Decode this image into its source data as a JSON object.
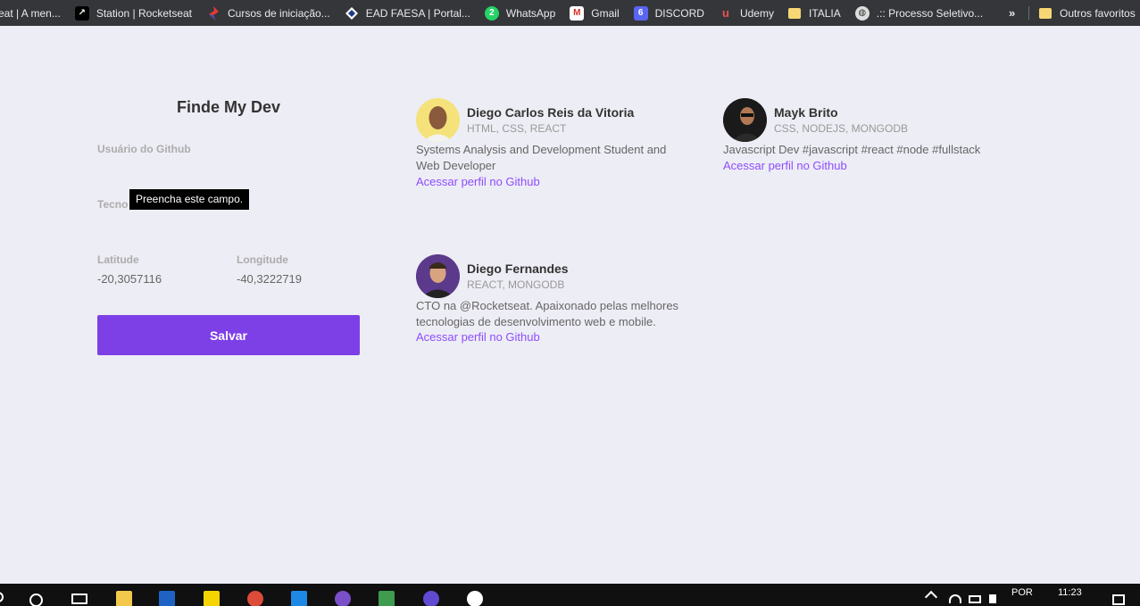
{
  "bookmarks_bar": {
    "items": [
      {
        "label": "eat | A men...",
        "icon": "page-icon",
        "color": "#35363a"
      },
      {
        "label": "Station | Rocketseat",
        "icon": "rocketseat-icon",
        "color": "#000000"
      },
      {
        "label": "Cursos de iniciação...",
        "icon": "bookmark-logo-icon",
        "color": "#e53935"
      },
      {
        "label": "EAD FAESA | Portal...",
        "icon": "faesa-icon",
        "color": "#1e3a8a"
      },
      {
        "label": "WhatsApp",
        "icon": "whatsapp-icon",
        "color": "#25d366"
      },
      {
        "label": "Gmail",
        "icon": "gmail-icon",
        "color": "#ffffff"
      },
      {
        "label": "DISCORD",
        "icon": "discord-icon",
        "color": "#5865f2"
      },
      {
        "label": "Udemy",
        "icon": "udemy-icon",
        "color": "#ec5252"
      },
      {
        "label": "ITALIA",
        "icon": "folder-icon",
        "color": "#f7d774"
      },
      {
        "label": ".:: Processo Seletivo...",
        "icon": "globe-icon",
        "color": "#dddddd"
      }
    ],
    "overflow_label": "»",
    "other_favorites": "Outros favoritos"
  },
  "form": {
    "title": "Finde My Dev",
    "github_label": "Usuário do Github",
    "techs_label": "Tecno",
    "tooltip": "Preencha este campo.",
    "latitude_label": "Latitude",
    "latitude_value": "-20,3057116",
    "longitude_label": "Longitude",
    "longitude_value": "-40,3222719",
    "save_label": "Salvar"
  },
  "devs": [
    {
      "name": "Diego Carlos Reis da Vitoria",
      "techs": "HTML, CSS, REACT",
      "bio": "Systems Analysis and Development Student and Web Developer",
      "link": "Acessar perfil no Github",
      "avatar_color": "#f5e27a"
    },
    {
      "name": "Mayk Brito",
      "techs": "CSS, NODEJS, MONGODB",
      "bio": "Javascript Dev #javascript #react #node #fullstack",
      "link": "Acessar perfil no Github",
      "avatar_color": "#1a1a1a"
    },
    {
      "name": "Diego Fernandes",
      "techs": "REACT, MONGODB",
      "bio": "CTO na @Rocketseat. Apaixonado pelas melhores tecnologias de desenvolvimento web e mobile.",
      "link": "Acessar perfil no Github",
      "avatar_color": "#5b3a8c"
    }
  ],
  "taskbar": {
    "language": "POR",
    "time": "11:23"
  }
}
